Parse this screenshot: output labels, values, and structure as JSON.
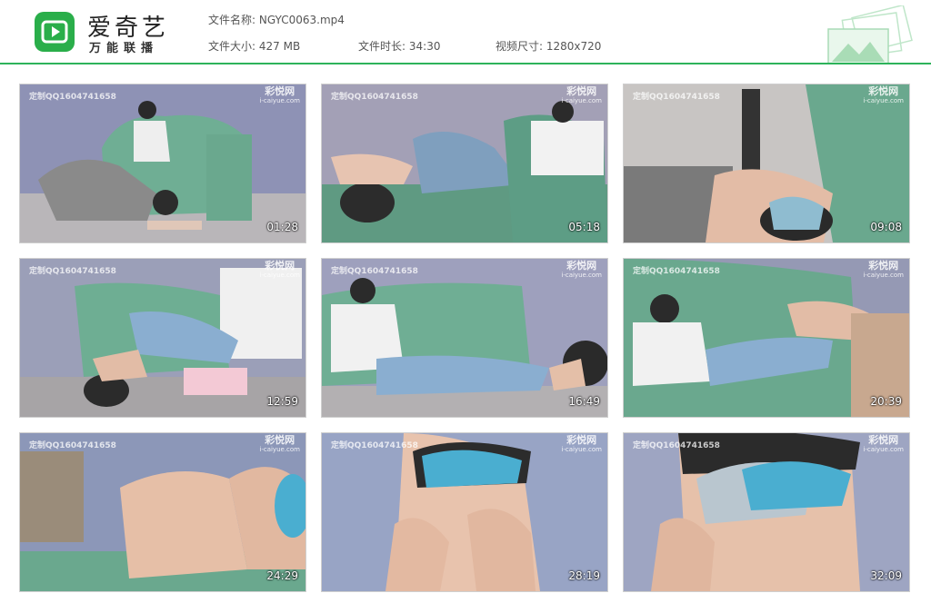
{
  "header": {
    "brand": "爱奇艺",
    "brand_sub": "万能联播",
    "file_name_label": "文件名称:",
    "file_name": "NGYC0063.mp4",
    "file_size_label": "文件大小:",
    "file_size": "427 MB",
    "duration_label": "文件时长:",
    "duration": "34:30",
    "resolution_label": "视频尺寸:",
    "resolution": "1280x720"
  },
  "colors": {
    "accent": "#2db35a",
    "logo": "#2aae4a"
  },
  "thumbnails": [
    {
      "time": "01:28",
      "wm_left": "定制QQ1604741658",
      "wm_brand": "彩悦网",
      "wm_site": "i-caiyue.com"
    },
    {
      "time": "05:18",
      "wm_left": "定制QQ1604741658",
      "wm_brand": "彩悦网",
      "wm_site": "i-caiyue.com"
    },
    {
      "time": "09:08",
      "wm_left": "定制QQ1604741658",
      "wm_brand": "彩悦网",
      "wm_site": "i-caiyue.com"
    },
    {
      "time": "12:59",
      "wm_left": "定制QQ1604741658",
      "wm_brand": "彩悦网",
      "wm_site": "i-caiyue.com"
    },
    {
      "time": "16:49",
      "wm_left": "定制QQ1604741658",
      "wm_brand": "彩悦网",
      "wm_site": "i-caiyue.com"
    },
    {
      "time": "20:39",
      "wm_left": "定制QQ1604741658",
      "wm_brand": "彩悦网",
      "wm_site": "i-caiyue.com"
    },
    {
      "time": "24:29",
      "wm_left": "定制QQ1604741658",
      "wm_brand": "彩悦网",
      "wm_site": "i-caiyue.com"
    },
    {
      "time": "28:19",
      "wm_left": "定制QQ1604741658",
      "wm_brand": "彩悦网",
      "wm_site": "i-caiyue.com"
    },
    {
      "time": "32:09",
      "wm_left": "定制QQ1604741658",
      "wm_brand": "彩悦网",
      "wm_site": "i-caiyue.com"
    }
  ]
}
